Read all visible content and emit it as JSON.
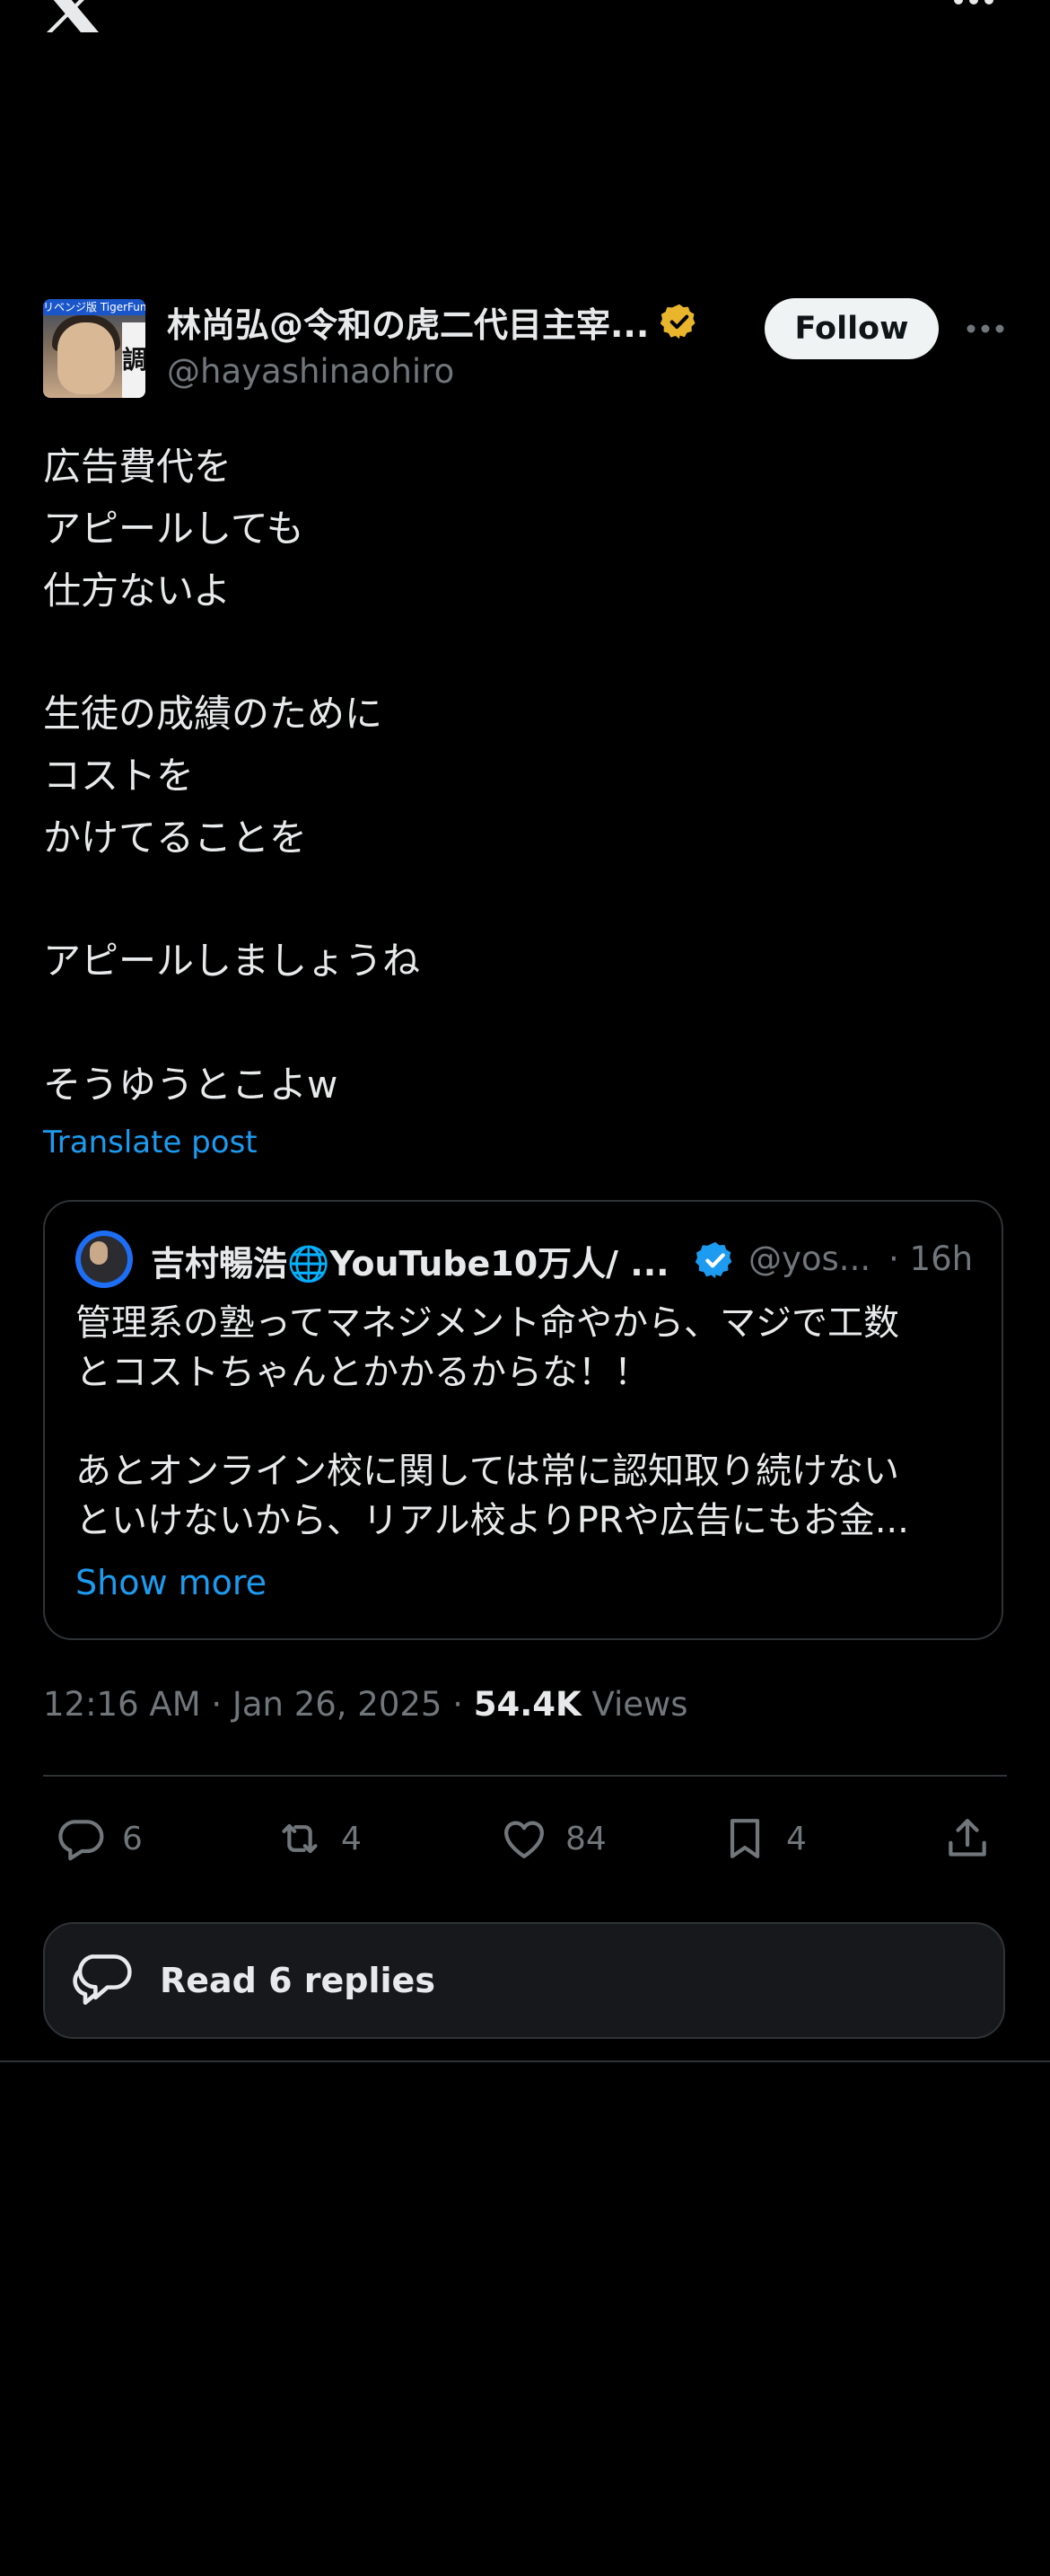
{
  "author": {
    "name": "林尚弘@令和の虎二代目主宰...",
    "handle": "@hayashinaohiro",
    "avatar_banner": "リベンジ版 TigerFunding",
    "avatar_side_text": "調"
  },
  "follow_label": "Follow",
  "post_text": "広告費代を\nアピールしても\n仕方ないよ\n\n生徒の成績のために\nコストを\nかけてることを\n\nアピールしましょうね\n\nそうゆうとこよw",
  "translate_label": "Translate post",
  "quote": {
    "name": "吉村暢浩🌐YouTube10万人/ ...",
    "handle": "@yos...",
    "time": "· 16h",
    "text": "管理系の塾ってマネジメント命やから、マジで工数\nとコストちゃんとかかるからな！！\n\nあとオンライン校に関しては常に認知取り続けない\nといけないから、リアル校よりPRや広告にもお金...",
    "show_more": "Show more"
  },
  "meta": {
    "time": "12:16 AM · Jan 26, 2025 · ",
    "views_count": "54.4K",
    "views_label": " Views"
  },
  "actions": {
    "replies": "6",
    "reposts": "4",
    "likes": "84",
    "bookmarks": "4"
  },
  "read_replies_label": "Read 6 replies",
  "colors": {
    "background": "#000000",
    "link": "#1d9bf0",
    "gold_verified": "#e8b52c",
    "blue_verified": "#1d9bf0",
    "muted": "#71767b"
  }
}
